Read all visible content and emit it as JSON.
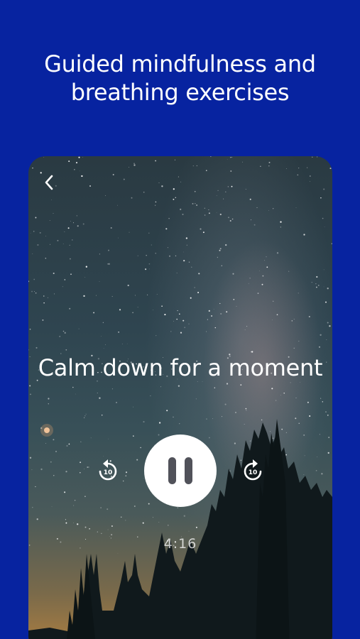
{
  "header": {
    "headline": "Guided mindfulness and\nbreathing exercises"
  },
  "player": {
    "session_title": "Calm down for a moment",
    "elapsed_time": "4:16",
    "skip_back_seconds": "10",
    "skip_forward_seconds": "10",
    "state": "playing"
  },
  "icons": {
    "back": "chevron-left-icon",
    "skip_back": "replay-10-icon",
    "skip_forward": "forward-10-icon",
    "pause": "pause-icon"
  },
  "colors": {
    "background": "#0723a0",
    "text": "#ffffff",
    "pause_button": "#ffffff",
    "pause_bars": "#51525a"
  }
}
